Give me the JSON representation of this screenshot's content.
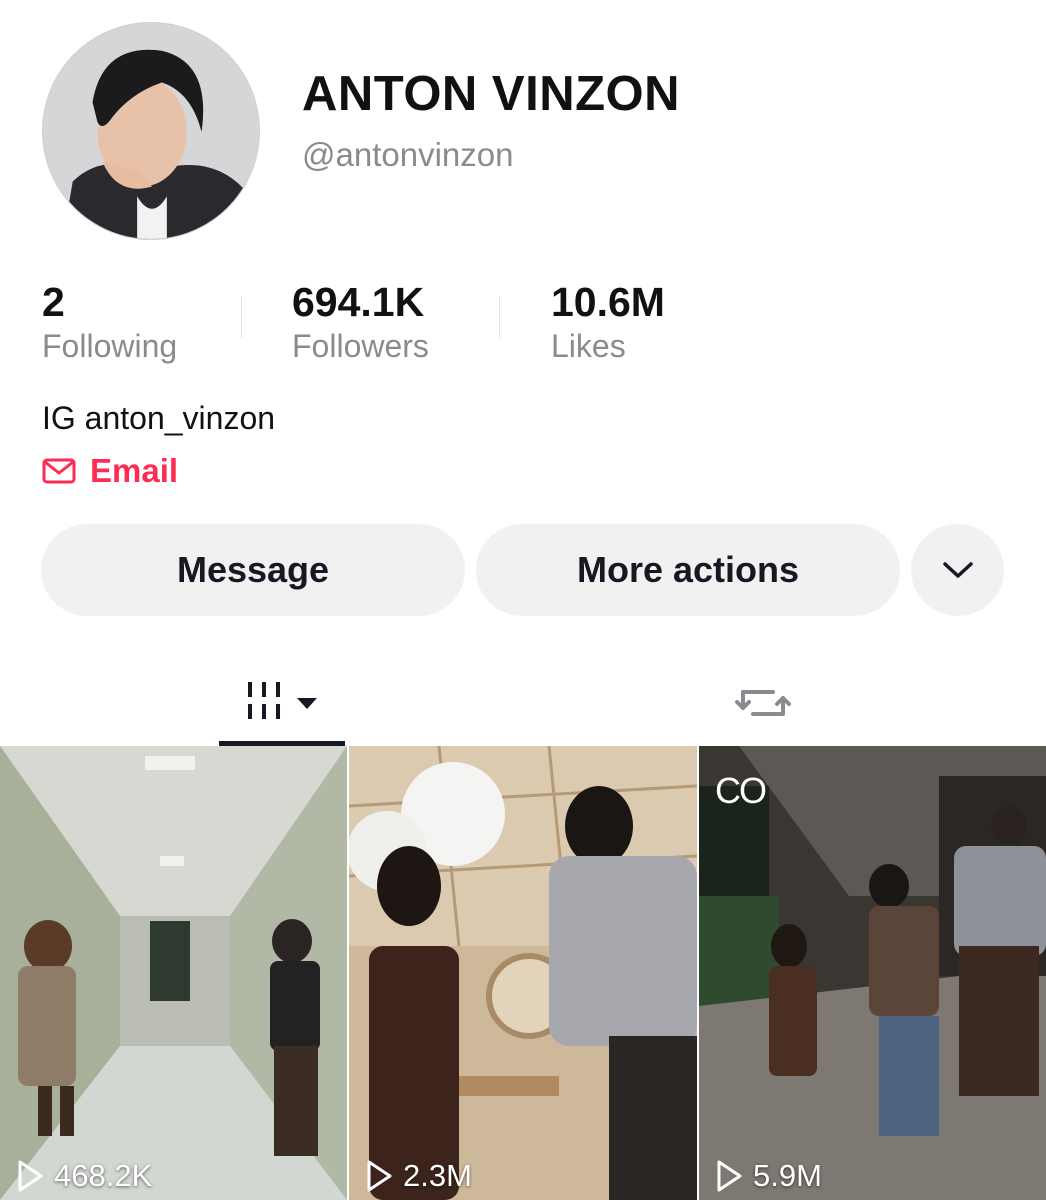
{
  "profile": {
    "display_name": "ANTON VINZON",
    "username": "@antonvinzon",
    "bio": "IG anton_vinzon",
    "email_label": "Email"
  },
  "stats": [
    {
      "value": "2",
      "label": "Following"
    },
    {
      "value": "694.1K",
      "label": "Followers"
    },
    {
      "value": "10.6M",
      "label": "Likes"
    }
  ],
  "actions": {
    "message_label": "Message",
    "more_label": "More actions"
  },
  "tabs": {
    "videos_icon": "video-grid-icon",
    "reposts_icon": "repost-icon"
  },
  "videos": [
    {
      "views": "468.2K",
      "badge": ""
    },
    {
      "views": "2.3M",
      "badge": ""
    },
    {
      "views": "5.9M",
      "badge": "CO"
    }
  ],
  "colors": {
    "accent": "#fe2c55",
    "text": "#161823",
    "muted": "#8a8b91",
    "button_bg": "#f1f1f2"
  }
}
